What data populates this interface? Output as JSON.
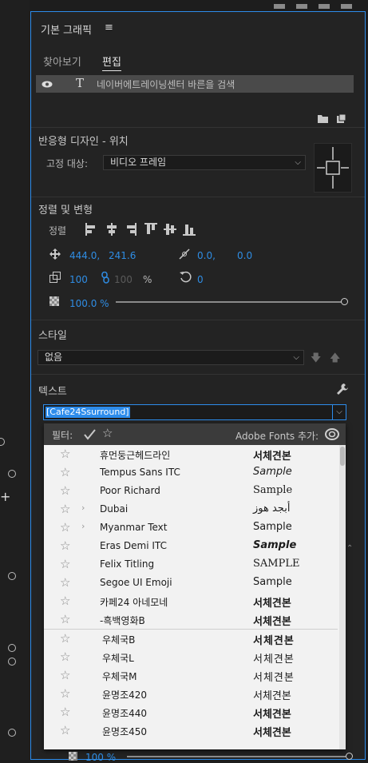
{
  "panel": {
    "title": "기본 그래픽",
    "menu_icon": "hamburger-icon"
  },
  "tabs": [
    {
      "label": "찾아보기"
    },
    {
      "label": "편집"
    }
  ],
  "layer": {
    "text": "네이버에트레이닝센터 바른을 검색"
  },
  "responsive": {
    "title": "반응형 디자인 - 위치",
    "pin_label": "고정 대상:",
    "pin_value": "비디오 프레임"
  },
  "align": {
    "title": "정렬 및 변형",
    "align_label": "정렬",
    "position_x": "444.0,",
    "position_y": "241.6",
    "anchor_x": "0.0,",
    "anchor_y": "0.0",
    "scale": "100",
    "scale_linked": "100",
    "percent": "%",
    "rotation": "0",
    "opacity": "100.0 %",
    "opacity_level": 1.0
  },
  "style": {
    "title": "스타일",
    "value": "없음"
  },
  "text_section": {
    "title": "텍스트",
    "font_value": "[Cafe24Ssurround]"
  },
  "font_popup": {
    "filter_label": "필터:",
    "adobe_fonts_label": "Adobe Fonts 추가:",
    "fonts": [
      {
        "name": "휴먼둥근헤드라인",
        "sample": "서체견본",
        "has_children": false
      },
      {
        "name": "Tempus Sans ITC",
        "sample": "Sample",
        "has_children": false
      },
      {
        "name": "Poor Richard",
        "sample": "Sample",
        "has_children": false
      },
      {
        "name": "Dubai",
        "sample": "أبجد هوز",
        "has_children": true
      },
      {
        "name": "Myanmar Text",
        "sample": "Sample",
        "has_children": true
      },
      {
        "name": "Eras Demi ITC",
        "sample": "Sample",
        "has_children": false
      },
      {
        "name": "Felix Titling",
        "sample": "SAMPLE",
        "has_children": false
      },
      {
        "name": "Segoe UI Emoji",
        "sample": "Sample",
        "has_children": false
      },
      {
        "name": "카페24 아네모네",
        "sample": "서체견본",
        "has_children": false
      },
      {
        "name": "-흑백영화B",
        "sample": "서체견본",
        "has_children": false
      },
      {
        "name": "우체국B",
        "sample": "서체견본",
        "has_children": false
      },
      {
        "name": "우체국L",
        "sample": "서체견본",
        "has_children": false
      },
      {
        "name": "우체국M",
        "sample": "서체견본",
        "has_children": false
      },
      {
        "name": "윤명조420",
        "sample": "서체견본",
        "has_children": false
      },
      {
        "name": "윤명조440",
        "sample": "서체견본",
        "has_children": false
      },
      {
        "name": "윤명조450",
        "sample": "서체견본",
        "has_children": false
      }
    ]
  },
  "bottom": {
    "opacity": "100 %"
  },
  "colors": {
    "accent": "#2d8ceb",
    "value_blue": "#2f8de4",
    "panel_bg": "#232323",
    "popup_bg": "#f2f2f2"
  }
}
